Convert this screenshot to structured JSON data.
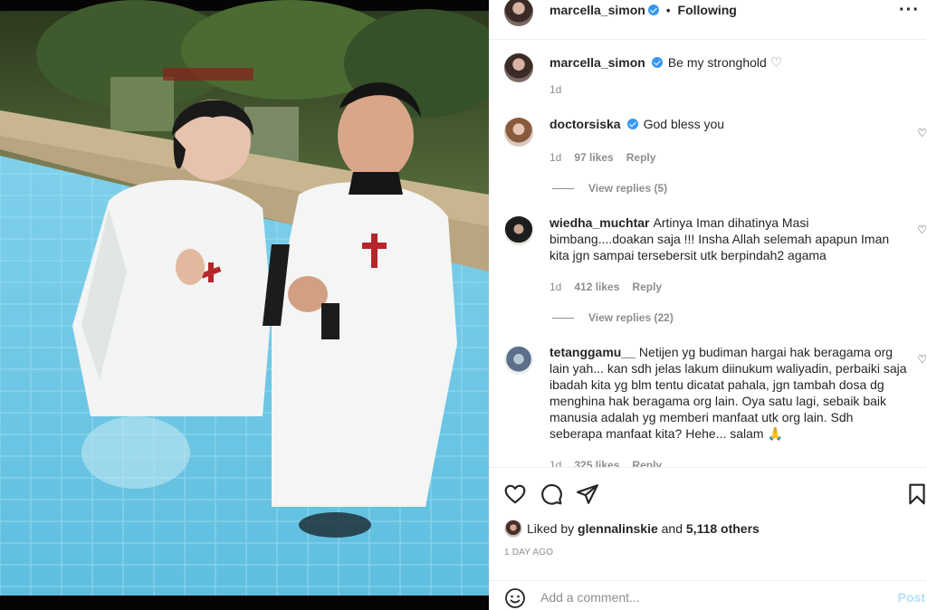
{
  "post": {
    "author": "marcella_simon",
    "follow_status": "Following",
    "more_icon": "more-horizontal-icon",
    "separator": "•"
  },
  "caption": {
    "username": "marcella_simon",
    "text": "Be my stronghold",
    "time": "1d"
  },
  "comments": [
    {
      "username": "doctorsiska",
      "verified": true,
      "text": "God bless you",
      "time": "1d",
      "likes": "97 likes",
      "reply": "Reply",
      "view_replies": "View replies (5)"
    },
    {
      "username": "wiedha_muchtar",
      "verified": false,
      "text": "Artinya Iman dihatinya Masi bimbang....doakan saja !!! Insha Allah selemah apapun Iman kita jgn sampai tersebersit utk berpindah2 agama",
      "time": "1d",
      "likes": "412 likes",
      "reply": "Reply",
      "view_replies": "View replies (22)"
    },
    {
      "username": "tetanggamu__",
      "verified": false,
      "text": "Netijen yg budiman hargai hak beragama org lain yah... kan sdh jelas lakum diinukum waliyadin, perbaiki saja ibadah kita yg blm tentu dicatat pahala, jgn tambah dosa dg menghina hak beragama org lain. Oya satu lagi, sebaik baik manusia adalah yg memberi manfaat utk org lain. Sdh seberapa manfaat kita? Hehe... salam 🙏",
      "time": "1d",
      "likes": "325 likes",
      "reply": "Reply"
    }
  ],
  "likes": {
    "prefix": "Liked by",
    "first_user": "glennalinskie",
    "joiner": "and",
    "others": "5,118 others"
  },
  "date": "1 DAY AGO",
  "composer": {
    "placeholder": "Add a comment...",
    "post_label": "Post"
  },
  "colors": {
    "verified": "#3897f0",
    "post_disabled": "#b2dffc",
    "muted": "#8e8e8e",
    "text": "#262626"
  }
}
